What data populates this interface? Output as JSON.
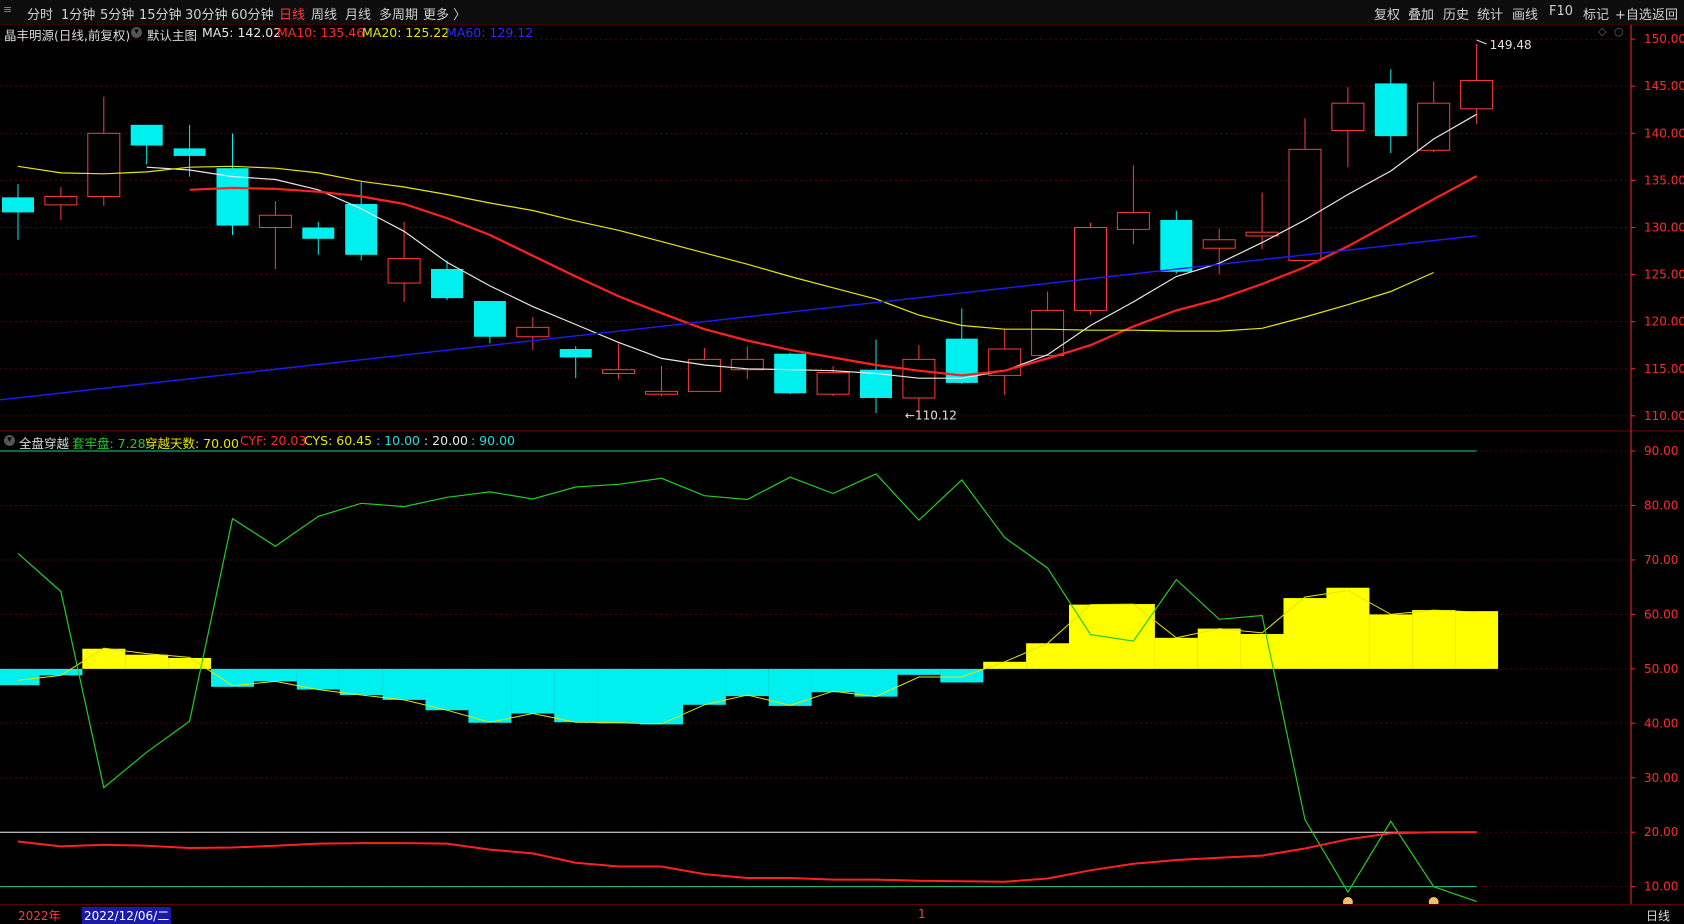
{
  "toolbar": {
    "left_icon": "≡",
    "periods": [
      "分时",
      "1分钟",
      "5分钟",
      "15分钟",
      "30分钟",
      "60分钟",
      "日线",
      "周线",
      "月线",
      "多周期",
      "更多 〉"
    ],
    "active_period": "日线",
    "right_buttons": [
      "复权",
      "叠加",
      "历史",
      "统计",
      "画线",
      "F10",
      "标记",
      "+自选",
      "返回"
    ]
  },
  "main_legend": {
    "stock": "晶丰明源(日线,前复权)",
    "template": "默认主图",
    "ma5": "MA5: 142.02",
    "ma10": "MA10: 135.46",
    "ma20": "MA20: 125.22",
    "ma60": "MA60: 129.12"
  },
  "sub_legend": {
    "name": "全盘穿越",
    "item1": "套牢盘: 7.28",
    "item2": "穿越天数: 70.00",
    "item3": "CYF: 20.03",
    "item4": "CYS: 60.45",
    "item5": ": 10.00",
    "item6": ": 20.00",
    "item7": ": 90.00"
  },
  "bottom": {
    "year": "2022年",
    "date": "2022/12/06/二",
    "marker": "1",
    "period": "日线"
  },
  "colors": {
    "up": "#ff3b3b",
    "down": "#00f0f0",
    "ma5": "#e8e8e8",
    "ma10": "#ff2020",
    "ma20": "#e6e600",
    "ma60": "#1c1cff",
    "grid": "#5a0000",
    "axis": "#ff2a2a",
    "bar_pos": "#ffff00",
    "bar_neg": "#00f0f0",
    "line_green": "#22cc22"
  },
  "chart_data": [
    {
      "type": "candlestick",
      "title": "晶丰明源(日线,前复权)",
      "y_ticks": [
        150.0,
        145.0,
        140.0,
        135.0,
        130.0,
        125.0,
        120.0,
        115.0,
        110.0
      ],
      "ylim": [
        108.5,
        151.5
      ],
      "annotations": {
        "high": "149.48",
        "low": "110.12"
      },
      "candles": [
        {
          "o": 133.2,
          "h": 134.6,
          "l": 128.7,
          "c": 131.6
        },
        {
          "o": 132.4,
          "h": 134.3,
          "l": 130.8,
          "c": 133.3
        },
        {
          "o": 133.3,
          "h": 143.9,
          "l": 132.3,
          "c": 140.0
        },
        {
          "o": 140.9,
          "h": 140.9,
          "l": 136.7,
          "c": 138.7
        },
        {
          "o": 138.4,
          "h": 140.9,
          "l": 135.4,
          "c": 137.6
        },
        {
          "o": 136.3,
          "h": 140.0,
          "l": 129.2,
          "c": 130.2
        },
        {
          "o": 130.0,
          "h": 132.8,
          "l": 125.6,
          "c": 131.3
        },
        {
          "o": 130.0,
          "h": 130.6,
          "l": 127.1,
          "c": 128.8
        },
        {
          "o": 132.5,
          "h": 134.8,
          "l": 126.5,
          "c": 127.1
        },
        {
          "o": 124.1,
          "h": 130.6,
          "l": 122.1,
          "c": 126.7
        },
        {
          "o": 125.6,
          "h": 126.5,
          "l": 122.3,
          "c": 122.5
        },
        {
          "o": 122.2,
          "h": 122.2,
          "l": 117.7,
          "c": 118.4
        },
        {
          "o": 118.4,
          "h": 120.5,
          "l": 117.0,
          "c": 119.4
        },
        {
          "o": 117.1,
          "h": 117.4,
          "l": 114.0,
          "c": 116.2
        },
        {
          "o": 114.5,
          "h": 117.7,
          "l": 113.9,
          "c": 114.9
        },
        {
          "o": 112.3,
          "h": 115.3,
          "l": 112.1,
          "c": 112.6
        },
        {
          "o": 112.6,
          "h": 117.2,
          "l": 112.6,
          "c": 116.0
        },
        {
          "o": 114.9,
          "h": 117.4,
          "l": 113.9,
          "c": 116.0
        },
        {
          "o": 116.6,
          "h": 116.7,
          "l": 112.3,
          "c": 112.4
        },
        {
          "o": 112.3,
          "h": 115.3,
          "l": 112.1,
          "c": 114.6
        },
        {
          "o": 114.9,
          "h": 118.1,
          "l": 110.3,
          "c": 111.9
        },
        {
          "o": 111.9,
          "h": 117.5,
          "l": 110.1,
          "c": 116.0
        },
        {
          "o": 118.2,
          "h": 121.4,
          "l": 113.4,
          "c": 113.5
        },
        {
          "o": 114.3,
          "h": 119.2,
          "l": 112.2,
          "c": 117.1
        },
        {
          "o": 116.4,
          "h": 123.2,
          "l": 116.4,
          "c": 121.2
        },
        {
          "o": 121.2,
          "h": 130.5,
          "l": 120.7,
          "c": 130.0
        },
        {
          "o": 129.8,
          "h": 136.6,
          "l": 128.2,
          "c": 131.6
        },
        {
          "o": 130.8,
          "h": 131.8,
          "l": 125.1,
          "c": 125.3
        },
        {
          "o": 127.8,
          "h": 129.9,
          "l": 125.0,
          "c": 128.7
        },
        {
          "o": 129.1,
          "h": 133.7,
          "l": 127.7,
          "c": 129.5
        },
        {
          "o": 126.5,
          "h": 141.6,
          "l": 126.3,
          "c": 138.3
        },
        {
          "o": 140.3,
          "h": 144.9,
          "l": 136.4,
          "c": 143.2
        },
        {
          "o": 145.3,
          "h": 146.8,
          "l": 137.9,
          "c": 139.7
        },
        {
          "o": 138.2,
          "h": 145.5,
          "l": 138.0,
          "c": 143.2
        },
        {
          "o": 142.6,
          "h": 149.48,
          "l": 141.0,
          "c": 145.6
        }
      ],
      "ma5": [
        null,
        null,
        null,
        null,
        136.4,
        136.1,
        135.4,
        135.1,
        134.0,
        132.0,
        129.6,
        126.3,
        123.8,
        121.6,
        119.7,
        117.8,
        116.1,
        115.4,
        115.0,
        114.9,
        114.8,
        114.5,
        114.0,
        114.0,
        114.8,
        116.5,
        119.6,
        122.1,
        124.8,
        126.2,
        128.4,
        130.8,
        133.5,
        136.0,
        139.4,
        142.02
      ],
      "ma10": [
        null,
        null,
        null,
        null,
        null,
        null,
        null,
        null,
        null,
        134.0,
        134.2,
        134.1,
        133.8,
        133.3,
        132.5,
        131.0,
        129.2,
        127.0,
        124.8,
        122.7,
        120.9,
        119.2,
        118.0,
        117.0,
        116.2,
        115.4,
        114.8,
        114.3,
        114.8,
        116.1,
        117.5,
        119.5,
        121.2,
        122.4,
        124.0,
        125.8,
        128.0,
        130.5,
        133.0,
        135.46
      ],
      "ma20": [
        136.5,
        135.8,
        135.7,
        135.9,
        136.4,
        136.5,
        136.3,
        135.8,
        134.9,
        134.3,
        133.5,
        132.6,
        131.8,
        130.7,
        129.7,
        128.5,
        127.3,
        126.1,
        124.8,
        123.6,
        122.4,
        120.7,
        119.6,
        119.2,
        119.2,
        119.1,
        119.1,
        119.0,
        119.0,
        119.3,
        120.5,
        121.8,
        123.2,
        125.22
      ],
      "ma60": [
        111.7,
        129.12
      ]
    },
    {
      "type": "bar_line_combo",
      "title": "全盘穿越",
      "y_ticks": [
        90.0,
        80.0,
        70.0,
        60.0,
        50.0,
        40.0,
        30.0,
        20.0,
        10.0
      ],
      "ylim": [
        7.0,
        93.5
      ],
      "baseline": 50.0,
      "hlines": [
        {
          "y": 90.0,
          "color": "green"
        },
        {
          "y": 20.0,
          "color": "white"
        },
        {
          "y": 10.0,
          "color": "green"
        }
      ],
      "bars": [
        47.0,
        48.8,
        53.7,
        52.6,
        52.0,
        46.7,
        47.7,
        46.2,
        45.2,
        44.3,
        42.4,
        40.1,
        41.8,
        40.2,
        40.0,
        39.8,
        43.4,
        45.0,
        43.2,
        45.7,
        44.9,
        48.9,
        47.5,
        51.3,
        54.7,
        61.8,
        61.9,
        55.7,
        57.4,
        56.4,
        63.0,
        64.9,
        60.0,
        60.8,
        60.6
      ],
      "yellow_line": [
        47.9,
        48.8,
        53.8,
        52.8,
        52.1,
        46.9,
        47.7,
        46.2,
        45.2,
        44.3,
        42.4,
        40.2,
        41.8,
        40.2,
        40.1,
        39.9,
        43.4,
        45.2,
        43.3,
        45.9,
        44.9,
        48.5,
        48.5,
        51.3,
        54.7,
        61.8,
        61.9,
        55.7,
        57.4,
        56.6,
        63.2,
        64.4,
        60.0,
        60.8,
        60.45
      ],
      "green_line": [
        71.2,
        64.2,
        28.2,
        34.7,
        40.4,
        77.6,
        72.5,
        78.0,
        80.4,
        79.8,
        81.5,
        82.5,
        81.2,
        83.4,
        83.9,
        85.0,
        81.8,
        81.1,
        85.2,
        82.2,
        85.8,
        77.3,
        84.7,
        74.1,
        68.5,
        56.3,
        55.1,
        66.4,
        59.1,
        59.8,
        22.3,
        9.0,
        22.0,
        10.0,
        7.28
      ],
      "red_line": [
        18.3,
        17.4,
        17.7,
        17.5,
        17.1,
        17.2,
        17.5,
        17.9,
        18.0,
        18.0,
        17.9,
        16.8,
        16.1,
        14.4,
        13.7,
        13.7,
        12.3,
        11.6,
        11.6,
        11.3,
        11.3,
        11.1,
        11.0,
        10.9,
        11.5,
        13.0,
        14.2,
        14.9,
        15.3,
        15.7,
        17.0,
        18.7,
        19.8,
        20.0,
        20.03
      ]
    }
  ]
}
